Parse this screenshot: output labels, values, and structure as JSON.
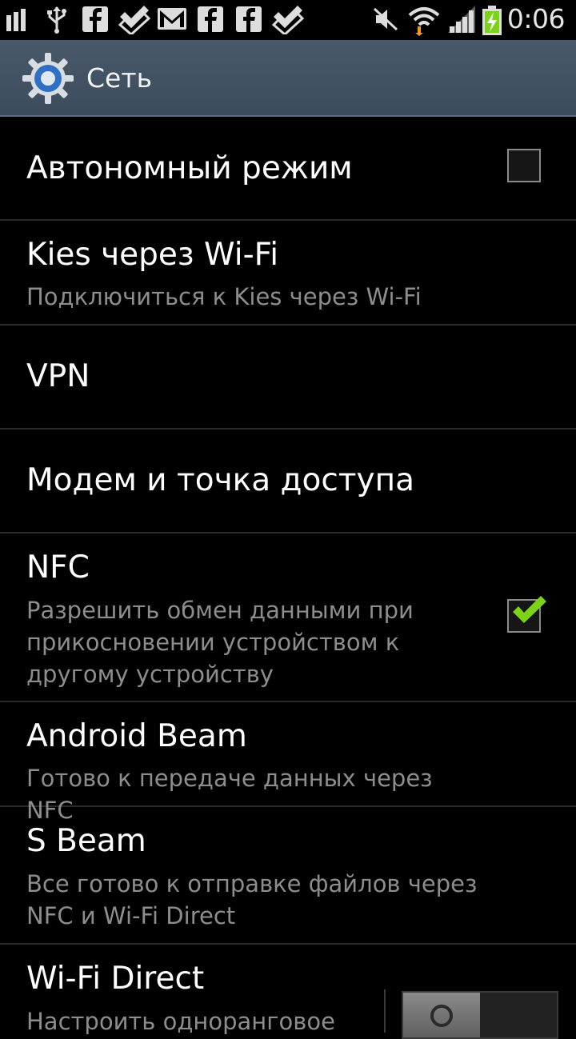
{
  "status_bar": {
    "time": "0:06",
    "icons": [
      "signal-bars-icon",
      "usb-icon",
      "facebook-icon",
      "check-notification-icon",
      "gmail-icon",
      "facebook-icon",
      "facebook-icon",
      "check-notification-icon",
      "mute-icon",
      "wifi-icon",
      "cell-signal-icon",
      "battery-charging-icon"
    ]
  },
  "action_bar": {
    "title": "Сеть",
    "icon": "settings-gear-icon"
  },
  "settings": {
    "airplane": {
      "title": "Автономный режим",
      "checked": false
    },
    "kies": {
      "title": "Kies через Wi-Fi",
      "summary": "Подключиться к Kies через Wi-Fi"
    },
    "vpn": {
      "title": "VPN"
    },
    "tethering": {
      "title": "Модем и точка доступа"
    },
    "nfc": {
      "title": "NFC",
      "summary": "Разрешить обмен данными при прикосновении устройством к другому устройству",
      "checked": true
    },
    "android_beam": {
      "title": "Android Beam",
      "summary": "Готово к передаче данных через NFC"
    },
    "s_beam": {
      "title": "S Beam",
      "summary": "Все готово к отправке файлов через NFC и Wi-Fi Direct"
    },
    "wifi_direct": {
      "title": "Wi-Fi Direct",
      "summary": "Настроить одноранговое",
      "toggle": "off"
    }
  },
  "colors": {
    "action_bar": "#44546a",
    "divider": "#2a2a2a",
    "summary_text": "#8d8d8d",
    "check_green": "#7bd219",
    "battery_green": "#7bd219",
    "wifi_arrow_orange": "#f09a1a"
  }
}
